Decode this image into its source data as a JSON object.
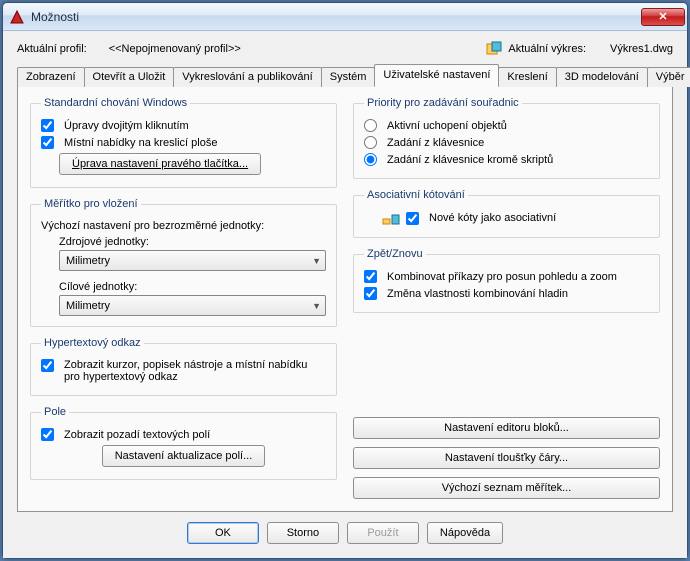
{
  "window": {
    "title": "Možnosti"
  },
  "profile": {
    "label": "Aktuální profil:",
    "value": "<<Nepojmenovaný profil>>",
    "drawing_label": "Aktuální výkres:",
    "drawing_value": "Výkres1.dwg"
  },
  "tabs": {
    "items": [
      "Zobrazení",
      "Otevřít a Uložit",
      "Vykreslování a publikování",
      "Systém",
      "Uživatelské nastavení",
      "Kreslení",
      "3D modelování",
      "Výběr"
    ],
    "active_index": 4
  },
  "groups": {
    "std": {
      "legend": "Standardní chování Windows",
      "cb1": "Úpravy dvojitým kliknutím",
      "cb2": "Místní nabídky na kreslicí ploše",
      "btn": "Úprava nastavení pravého tlačítka..."
    },
    "scale": {
      "legend": "Měřítko pro vložení",
      "desc": "Výchozí nastavení pro bezrozměrné jednotky:",
      "src_label": "Zdrojové jednotky:",
      "src_value": "Milimetry",
      "tgt_label": "Cílové jednotky:",
      "tgt_value": "Milimetry"
    },
    "hyper": {
      "legend": "Hypertextový odkaz",
      "cb": "Zobrazit kurzor, popisek nástroje a místní nabídku pro hypertextový odkaz"
    },
    "field": {
      "legend": "Pole",
      "cb": "Zobrazit pozadí textových polí",
      "btn": "Nastavení aktualizace polí..."
    },
    "priority": {
      "legend": "Priority pro zadávání souřadnic",
      "r1": "Aktivní uchopení objektů",
      "r2": "Zadání z klávesnice",
      "r3": "Zadání z klávesnice kromě skriptů"
    },
    "assoc": {
      "legend": "Asociativní kótování",
      "cb": "Nové kóty jako asociativní"
    },
    "undo": {
      "legend": "Zpět/Znovu",
      "cb1": "Kombinovat příkazy pro posun pohledu a zoom",
      "cb2": "Změna vlastnosti kombinování hladin"
    }
  },
  "buttons": {
    "block_editor": "Nastavení editoru bloků...",
    "lineweight": "Nastavení tloušťky čáry...",
    "scale_list": "Výchozí seznam měřítek..."
  },
  "footer": {
    "ok": "OK",
    "cancel": "Storno",
    "apply": "Použít",
    "help": "Nápověda"
  }
}
